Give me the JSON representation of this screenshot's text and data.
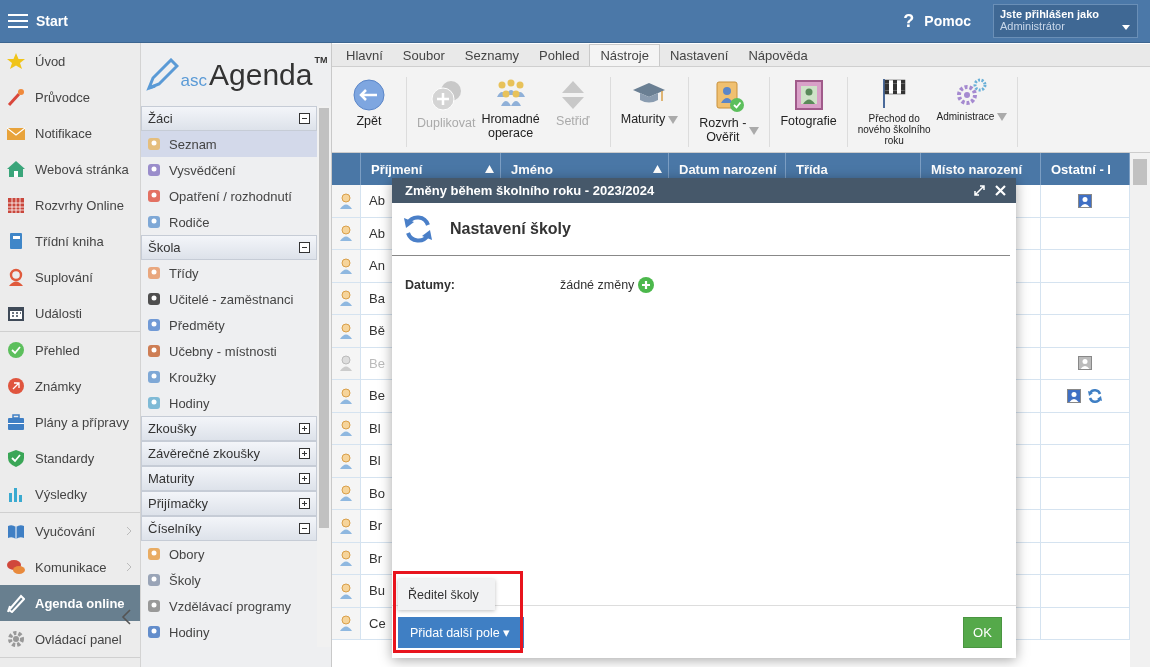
{
  "topbar": {
    "title": "Start",
    "help_icon": "?",
    "help": "Pomoc",
    "user": {
      "caption": "Jste přihlášen jako",
      "name": "Administrátor"
    }
  },
  "nav": {
    "sections": [
      {
        "items": [
          {
            "label": "Úvod",
            "selected": false,
            "submenu": false
          },
          {
            "label": "Průvodce",
            "selected": false,
            "submenu": false
          },
          {
            "label": "Notifikace",
            "selected": false,
            "submenu": false
          },
          {
            "label": "Webová stránka",
            "selected": false,
            "submenu": false
          },
          {
            "label": "Rozvrhy Online",
            "selected": false,
            "submenu": false
          },
          {
            "label": "Třídní kniha",
            "selected": false,
            "submenu": false
          },
          {
            "label": "Suplování",
            "selected": false,
            "submenu": false
          },
          {
            "label": "Události",
            "selected": false,
            "submenu": false
          }
        ]
      },
      {
        "items": [
          {
            "label": "Přehled",
            "selected": false,
            "submenu": false
          },
          {
            "label": "Známky",
            "selected": false,
            "submenu": false
          },
          {
            "label": "Plány a přípravy",
            "selected": false,
            "submenu": false
          },
          {
            "label": "Standardy",
            "selected": false,
            "submenu": false
          },
          {
            "label": "Výsledky",
            "selected": false,
            "submenu": false
          }
        ]
      },
      {
        "items": [
          {
            "label": "Vyučování",
            "selected": false,
            "submenu": true
          },
          {
            "label": "Komunikace",
            "selected": false,
            "submenu": true
          },
          {
            "label": "Agenda online",
            "selected": true,
            "submenu": false
          },
          {
            "label": "Ovládací panel",
            "selected": false,
            "submenu": false
          }
        ]
      }
    ]
  },
  "logo": {
    "prefix": "asc",
    "name": "Agenda",
    "mark": "TM"
  },
  "tree": {
    "groups": [
      {
        "label": "Žáci",
        "expanded": true,
        "items": [
          {
            "label": "Seznam",
            "selected": true
          },
          {
            "label": "Vysvědčení",
            "selected": false
          },
          {
            "label": "Opatření / rozhodnutí",
            "selected": false
          },
          {
            "label": "Rodiče",
            "selected": false
          }
        ]
      },
      {
        "label": "Škola",
        "expanded": true,
        "items": [
          {
            "label": "Třídy",
            "selected": false
          },
          {
            "label": "Učitelé - zaměstnanci",
            "selected": false
          },
          {
            "label": "Předměty",
            "selected": false
          },
          {
            "label": "Učebny - místnosti",
            "selected": false
          },
          {
            "label": "Kroužky",
            "selected": false
          },
          {
            "label": "Hodiny",
            "selected": false
          }
        ]
      },
      {
        "label": "Zkoušky",
        "expanded": false
      },
      {
        "label": "Závěrečné zkoušky",
        "expanded": false
      },
      {
        "label": "Maturity",
        "expanded": false
      },
      {
        "label": "Přijímačky",
        "expanded": false
      },
      {
        "label": "Číselníky",
        "expanded": true,
        "items": [
          {
            "label": "Obory",
            "selected": false
          },
          {
            "label": "Školy",
            "selected": false
          },
          {
            "label": "Vzdělávací programy",
            "selected": false
          },
          {
            "label": "Hodiny",
            "selected": false
          }
        ]
      }
    ]
  },
  "tabs": [
    {
      "label": "Hlavní",
      "selected": false
    },
    {
      "label": "Soubor",
      "selected": false
    },
    {
      "label": "Seznamy",
      "selected": false
    },
    {
      "label": "Pohled",
      "selected": false
    },
    {
      "label": "Nástroje",
      "selected": true
    },
    {
      "label": "Nastavení",
      "selected": false
    },
    {
      "label": "Nápověda",
      "selected": false
    }
  ],
  "ribbon": {
    "groups": [
      {
        "items": [
          {
            "label": "Zpět",
            "disabled": false,
            "dropdown": false,
            "kind": "standard"
          }
        ]
      },
      {
        "items": [
          {
            "label": "Duplikovat",
            "disabled": true,
            "dropdown": false,
            "kind": "standard"
          },
          {
            "label": "Hromadné\noperace",
            "disabled": false,
            "dropdown": false,
            "kind": "standard"
          },
          {
            "label": "Setřiď",
            "disabled": true,
            "dropdown": false,
            "kind": "standard"
          }
        ]
      },
      {
        "items": [
          {
            "label": "Maturity",
            "disabled": false,
            "dropdown": true,
            "kind": "standard"
          }
        ]
      },
      {
        "items": [
          {
            "label": "Rozvrh -\nOvěřit",
            "disabled": false,
            "dropdown": true,
            "kind": "standard"
          }
        ]
      },
      {
        "items": [
          {
            "label": "Fotografie",
            "disabled": false,
            "dropdown": false,
            "kind": "standard"
          }
        ]
      },
      {
        "items": [
          {
            "label": "Přechod do\nnového školního\nroku",
            "disabled": false,
            "dropdown": false,
            "kind": "compact"
          },
          {
            "label": "Administrace",
            "disabled": false,
            "dropdown": true,
            "kind": "compact"
          }
        ]
      }
    ]
  },
  "table": {
    "columns": [
      {
        "label": "Příjmení",
        "sorted": true
      },
      {
        "label": "Jméno",
        "sorted": true
      },
      {
        "label": "Datum narození",
        "sorted": false
      },
      {
        "label": "Třída",
        "sorted": false
      },
      {
        "label": "Místo narození",
        "sorted": false
      },
      {
        "label": "Ostatní - I",
        "sorted": false
      }
    ],
    "rows": [
      {
        "surname": "Ab",
        "disabled": false,
        "card": true,
        "sync": false
      },
      {
        "surname": "Ab",
        "disabled": false,
        "card": false,
        "sync": false
      },
      {
        "surname": "An",
        "disabled": false,
        "card": false,
        "sync": false
      },
      {
        "surname": "Ba",
        "disabled": false,
        "card": false,
        "sync": false
      },
      {
        "surname": "Bě",
        "disabled": false,
        "card": false,
        "sync": false
      },
      {
        "surname": "Be",
        "disabled": true,
        "card": true,
        "sync": false
      },
      {
        "surname": "Be",
        "disabled": false,
        "card": true,
        "sync": true
      },
      {
        "surname": "Bl",
        "disabled": false,
        "card": false,
        "sync": false
      },
      {
        "surname": "Bl",
        "disabled": false,
        "card": false,
        "sync": false
      },
      {
        "surname": "Bo",
        "disabled": false,
        "card": false,
        "sync": false
      },
      {
        "surname": "Br",
        "disabled": false,
        "card": false,
        "sync": false
      },
      {
        "surname": "Br",
        "disabled": false,
        "card": false,
        "sync": false
      },
      {
        "surname": "Bu",
        "disabled": false,
        "card": false,
        "sync": false
      },
      {
        "surname": "Ce",
        "disabled": false,
        "card": false,
        "sync": false
      }
    ]
  },
  "dialog": {
    "title": "Změny během školního roku - 2023/2024",
    "heading": "Nastavení školy",
    "fields": [
      {
        "label": "Datumy:",
        "value": "žádné změny",
        "addable": true
      }
    ],
    "menu_open": true,
    "menu": [
      {
        "label": "Ředitel školy",
        "selected": false
      }
    ],
    "add_button": "Přidat další pole ▾",
    "ok_button": "OK",
    "highlighted": true
  }
}
